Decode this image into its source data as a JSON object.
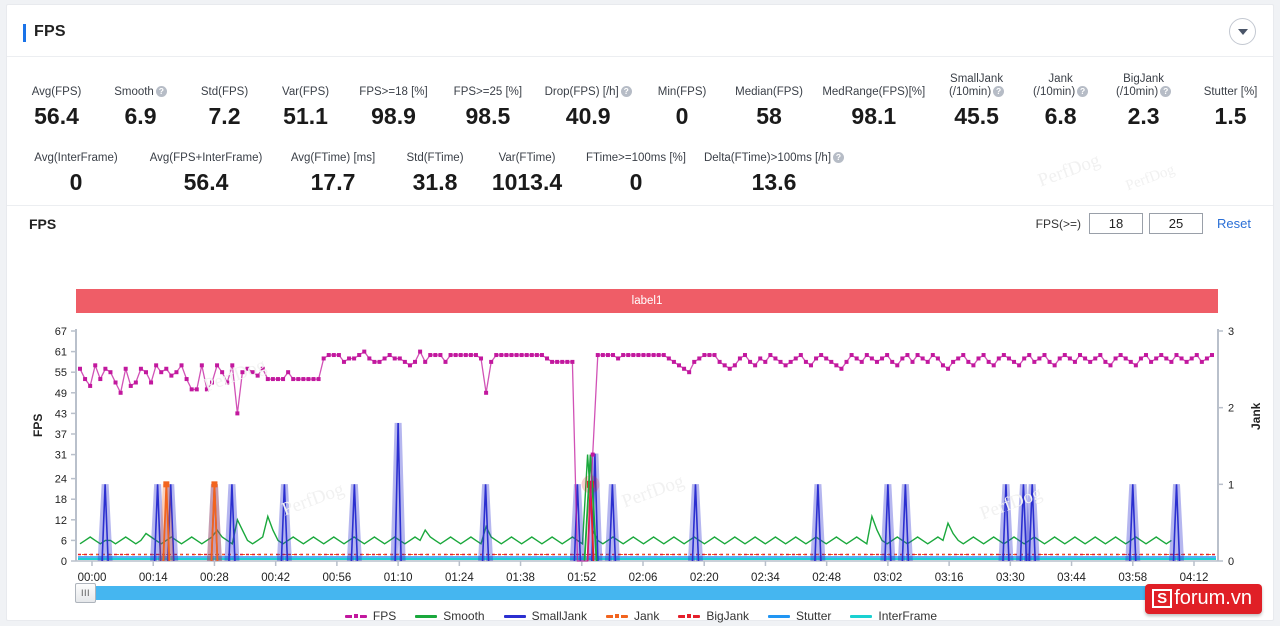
{
  "header": {
    "title": "FPS",
    "collapse_icon": "chevron-down-icon"
  },
  "stats_row1": [
    {
      "label": "Avg(FPS)",
      "value": "56.4",
      "help": false
    },
    {
      "label": "Smooth",
      "value": "6.9",
      "help": true
    },
    {
      "label": "Std(FPS)",
      "value": "7.2",
      "help": false
    },
    {
      "label": "Var(FPS)",
      "value": "51.1",
      "help": false
    },
    {
      "label": "FPS>=18 [%]",
      "value": "98.9",
      "help": false
    },
    {
      "label": "FPS>=25 [%]",
      "value": "98.5",
      "help": false
    },
    {
      "label": "Drop(FPS) [/h]",
      "value": "40.9",
      "help": true
    },
    {
      "label": "Min(FPS)",
      "value": "0",
      "help": false
    },
    {
      "label": "Median(FPS)",
      "value": "58",
      "help": false
    },
    {
      "label": "MedRange(FPS)[%]",
      "value": "98.1",
      "help": false
    },
    {
      "label": "SmallJank\n(/10min)",
      "value": "45.5",
      "help": true
    },
    {
      "label": "Jank\n(/10min)",
      "value": "6.8",
      "help": true
    },
    {
      "label": "BigJank\n(/10min)",
      "value": "2.3",
      "help": true
    },
    {
      "label": "Stutter [%]",
      "value": "1.5",
      "help": false
    }
  ],
  "stats_row2": [
    {
      "label": "Avg(InterFrame)",
      "value": "0",
      "help": false
    },
    {
      "label": "Avg(FPS+InterFrame)",
      "value": "56.4",
      "help": false
    },
    {
      "label": "Avg(FTime) [ms]",
      "value": "17.7",
      "help": false
    },
    {
      "label": "Std(FTime)",
      "value": "31.8",
      "help": false
    },
    {
      "label": "Var(FTime)",
      "value": "1013.4",
      "help": false
    },
    {
      "label": "FTime>=100ms [%]",
      "value": "0",
      "help": false
    },
    {
      "label": "Delta(FTime)>100ms [/h]",
      "value": "13.6",
      "help": true
    }
  ],
  "chart_header": {
    "title": "FPS",
    "threshold_label": "FPS(>=)",
    "threshold_1": "18",
    "threshold_2": "25",
    "reset_label": "Reset"
  },
  "label_banner": {
    "text": "label1",
    "color": "#ef5d67"
  },
  "slider": {
    "handle_glyph": "III",
    "track_color": "#45b6f0"
  },
  "watermarks": {
    "perfdog": "PerfDog",
    "sforum_mark": "S",
    "sforum_text": "forum.vn"
  },
  "chart_data": {
    "type": "line",
    "title": "FPS",
    "xlabel": "",
    "ylabel": "FPS",
    "y2label": "Jank",
    "ylim": [
      0,
      67
    ],
    "y2lim": [
      0,
      3
    ],
    "grid": false,
    "legend_position": "bottom",
    "yticks": [
      0,
      6,
      12,
      18,
      24,
      31,
      37,
      43,
      49,
      55,
      61,
      67
    ],
    "y2ticks": [
      0,
      1,
      2,
      3
    ],
    "xticks": [
      "00:00",
      "00:14",
      "00:28",
      "00:42",
      "00:56",
      "01:10",
      "01:24",
      "01:38",
      "01:52",
      "02:06",
      "02:20",
      "02:34",
      "02:48",
      "03:02",
      "03:16",
      "03:30",
      "03:44",
      "03:58",
      "04:12"
    ],
    "series": [
      {
        "name": "FPS",
        "color": "#c2189e",
        "axis": "left",
        "marker": true,
        "values": [
          56,
          53,
          51,
          57,
          53,
          56,
          55,
          52,
          49,
          56,
          51,
          52,
          56,
          55,
          52,
          57,
          55,
          56,
          54,
          55,
          57,
          53,
          50,
          50,
          57,
          50,
          52,
          57,
          55,
          52,
          57,
          43,
          55,
          56,
          55,
          54,
          56,
          53,
          53,
          53,
          53,
          55,
          53,
          53,
          53,
          53,
          53,
          53,
          59,
          60,
          60,
          60,
          58,
          59,
          59,
          60,
          61,
          59,
          58,
          58,
          59,
          60,
          59,
          59,
          58,
          57,
          58,
          61,
          58,
          60,
          60,
          60,
          58,
          60,
          60,
          60,
          60,
          60,
          60,
          59,
          49,
          58,
          60,
          60,
          60,
          60,
          60,
          60,
          60,
          60,
          60,
          60,
          59,
          58,
          58,
          58,
          58,
          58,
          0,
          0,
          0,
          31,
          60,
          60,
          60,
          60,
          59,
          60,
          60,
          60,
          60,
          60,
          60,
          60,
          60,
          60,
          59,
          58,
          57,
          56,
          55,
          58,
          59,
          60,
          60,
          60,
          58,
          57,
          56,
          57,
          59,
          60,
          58,
          57,
          59,
          58,
          60,
          59,
          58,
          57,
          58,
          59,
          60,
          58,
          57,
          59,
          60,
          59,
          58,
          57,
          56,
          58,
          60,
          59,
          58,
          60,
          59,
          58,
          59,
          60,
          58,
          57,
          59,
          60,
          58,
          60,
          59,
          58,
          60,
          59,
          57,
          56,
          58,
          59,
          60,
          58,
          57,
          59,
          60,
          58,
          57,
          59,
          60,
          59,
          58,
          57,
          59,
          60,
          58,
          59,
          60,
          58,
          57,
          59,
          60,
          59,
          58,
          60,
          59,
          58,
          59,
          60,
          58,
          57,
          59,
          60,
          59,
          58,
          57,
          59,
          60,
          58,
          59,
          60,
          59,
          58,
          60,
          59,
          58,
          59,
          60,
          58,
          59,
          60
        ]
      },
      {
        "name": "Smooth",
        "color": "#1aa83c",
        "axis": "left",
        "marker": false,
        "values": [
          5,
          6,
          7,
          6,
          5,
          6,
          6,
          5,
          6,
          7,
          6,
          5,
          6,
          8,
          7,
          6,
          5,
          6,
          7,
          6,
          5,
          6,
          7,
          6,
          5,
          6,
          7,
          9,
          7,
          6,
          5,
          12,
          9,
          6,
          5,
          6,
          7,
          13,
          9,
          6,
          5,
          6,
          7,
          6,
          5,
          6,
          7,
          6,
          5,
          6,
          7,
          6,
          5,
          6,
          7,
          6,
          5,
          6,
          7,
          6,
          5,
          6,
          7,
          6,
          5,
          6,
          7,
          6,
          9,
          7,
          6,
          5,
          6,
          7,
          6,
          5,
          6,
          7,
          6,
          5,
          10,
          7,
          6,
          5,
          6,
          7,
          6,
          5,
          6,
          7,
          6,
          5,
          6,
          7,
          6,
          5,
          6,
          7,
          6,
          5,
          31,
          9,
          6,
          5,
          6,
          7,
          6,
          5,
          6,
          7,
          6,
          5,
          6,
          7,
          6,
          5,
          6,
          7,
          6,
          5,
          6,
          7,
          6,
          5,
          6,
          7,
          6,
          5,
          6,
          7,
          6,
          5,
          6,
          7,
          6,
          5,
          6,
          7,
          6,
          5,
          6,
          7,
          6,
          5,
          6,
          7,
          6,
          5,
          6,
          7,
          6,
          5,
          6,
          7,
          6,
          5,
          13,
          9,
          6,
          5,
          6,
          7,
          6,
          5,
          6,
          7,
          6,
          5,
          6,
          7,
          6,
          11,
          8,
          6,
          5,
          6,
          7,
          6,
          5,
          6,
          7,
          6,
          5,
          6,
          7,
          6,
          5,
          6,
          7,
          6,
          5,
          6,
          7,
          6,
          5,
          6,
          7,
          6,
          5,
          6,
          7,
          6,
          5,
          6,
          7,
          6,
          5,
          6,
          7,
          6,
          5,
          6,
          7,
          6,
          5,
          6
        ]
      },
      {
        "name": "SmallJank",
        "color": "#2b2fd0",
        "axis": "right",
        "marker": false,
        "spikes": [
          {
            "x": "00:03",
            "value": 1.0
          },
          {
            "x": "00:15",
            "value": 1.0
          },
          {
            "x": "00:18",
            "value": 1.0
          },
          {
            "x": "00:28",
            "value": 1.0
          },
          {
            "x": "00:32",
            "value": 1.0
          },
          {
            "x": "00:44",
            "value": 1.0
          },
          {
            "x": "01:00",
            "value": 1.0
          },
          {
            "x": "01:10",
            "value": 1.8
          },
          {
            "x": "01:30",
            "value": 1.0
          },
          {
            "x": "01:51",
            "value": 1.0
          },
          {
            "x": "01:55",
            "value": 1.4
          },
          {
            "x": "01:59",
            "value": 1.0
          },
          {
            "x": "02:18",
            "value": 1.0
          },
          {
            "x": "02:46",
            "value": 1.0
          },
          {
            "x": "03:02",
            "value": 1.0
          },
          {
            "x": "03:06",
            "value": 1.0
          },
          {
            "x": "03:29",
            "value": 1.0
          },
          {
            "x": "03:33",
            "value": 1.0
          },
          {
            "x": "03:35",
            "value": 1.0
          },
          {
            "x": "03:58",
            "value": 1.0
          },
          {
            "x": "04:08",
            "value": 1.0
          }
        ]
      },
      {
        "name": "Jank",
        "color": "#f2641e",
        "axis": "right",
        "marker": true,
        "spikes": [
          {
            "x": "00:17",
            "value": 1.0
          },
          {
            "x": "00:28",
            "value": 1.0
          }
        ]
      },
      {
        "name": "BigJank",
        "color": "#e5202b",
        "axis": "right",
        "marker": true,
        "spikes": [
          {
            "x": "01:54",
            "value": 1.0
          }
        ]
      },
      {
        "name": "Stutter",
        "color": "#2196f3",
        "axis": "right",
        "marker": false,
        "values_note": "flat near 0 baseline with small bumps at jank points"
      },
      {
        "name": "InterFrame",
        "color": "#1ad1d1",
        "axis": "right",
        "marker": false,
        "values_note": "flat at 0 baseline"
      }
    ]
  },
  "legend": [
    {
      "label": "FPS",
      "color": "#c2189e",
      "dot": true
    },
    {
      "label": "Smooth",
      "color": "#1aa83c",
      "dot": false
    },
    {
      "label": "SmallJank",
      "color": "#2b2fd0",
      "dot": false
    },
    {
      "label": "Jank",
      "color": "#f2641e",
      "dot": true
    },
    {
      "label": "BigJank",
      "color": "#e5202b",
      "dot": true
    },
    {
      "label": "Stutter",
      "color": "#2196f3",
      "dot": false
    },
    {
      "label": "InterFrame",
      "color": "#1ad1d1",
      "dot": false
    }
  ]
}
